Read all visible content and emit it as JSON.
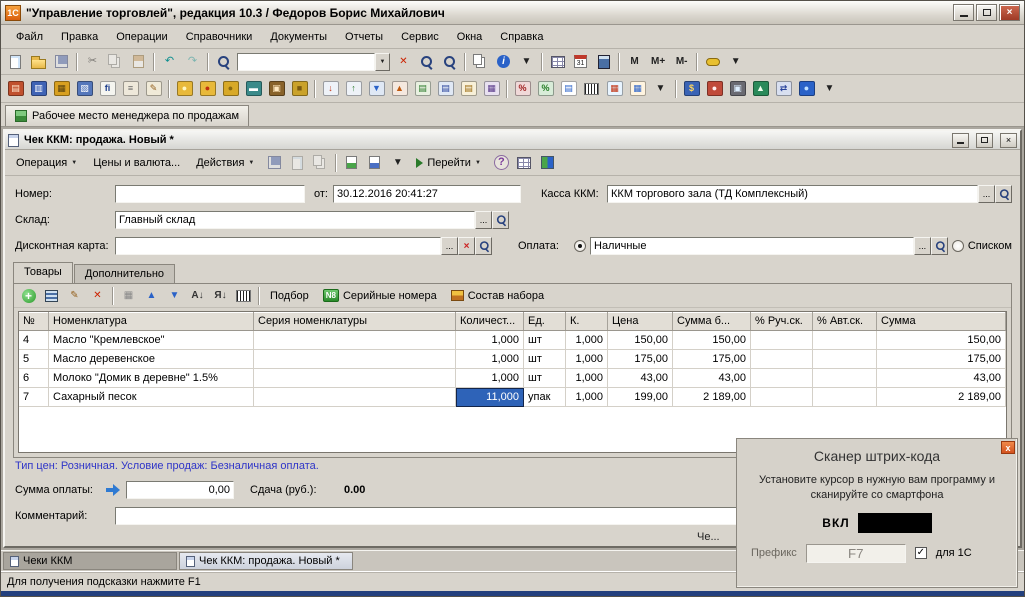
{
  "colors": {
    "selection_blue": "#2e63b8",
    "info_text_blue": "#2f35c8",
    "logo_orange": "#d95f0e",
    "bottom_strip_navy": "#23407e"
  },
  "ui": {
    "ellipsis": "...",
    "dropdown": "▼",
    "clear": "×"
  },
  "window": {
    "title": "\"Управление торговлей\", редакция 10.3 / Федоров Борис Михайлович"
  },
  "menu": {
    "items": [
      {
        "id": "file",
        "label": "Файл"
      },
      {
        "id": "edit",
        "label": "Правка"
      },
      {
        "id": "operations",
        "label": "Операции"
      },
      {
        "id": "catalogs",
        "label": "Справочники"
      },
      {
        "id": "documents",
        "label": "Документы"
      },
      {
        "id": "reports",
        "label": "Отчеты"
      },
      {
        "id": "service",
        "label": "Сервис"
      },
      {
        "id": "windows",
        "label": "Окна"
      },
      {
        "id": "help",
        "label": "Справка"
      }
    ]
  },
  "toolbar1": {
    "items": [
      {
        "n": "new-document",
        "s": "page"
      },
      {
        "n": "open-file",
        "s": "folder"
      },
      {
        "n": "save",
        "s": "floppy",
        "dim": true
      },
      {
        "t": "sep"
      },
      {
        "n": "cut",
        "g": "✂",
        "dim": true
      },
      {
        "n": "copy",
        "s": "copy",
        "dim": true
      },
      {
        "n": "paste",
        "s": "paste",
        "dim": true
      },
      {
        "t": "sep"
      },
      {
        "n": "undo",
        "g": "↶",
        "fg": "#0e8f8f"
      },
      {
        "n": "redo",
        "g": "↷",
        "fg": "#0e8f8f",
        "dim": true
      },
      {
        "t": "sep"
      },
      {
        "n": "find",
        "s": "mag"
      },
      {
        "t": "combo",
        "n": "quick-search",
        "v": ""
      },
      {
        "n": "clear-find",
        "t": "txt",
        "g": "✕",
        "fg": "#cc2200"
      },
      {
        "n": "find-next",
        "s": "mag"
      },
      {
        "n": "find-previous",
        "s": "mag"
      },
      {
        "t": "sep"
      },
      {
        "n": "copy-to-clipboard",
        "s": "copy"
      },
      {
        "n": "clipboard-info",
        "s": "info",
        "g": "i"
      },
      {
        "n": "info-dropdown",
        "t": "txt",
        "g": "▼",
        "fg": "#222"
      },
      {
        "t": "sep"
      },
      {
        "n": "show-table",
        "s": "grid"
      },
      {
        "n": "calendar",
        "s": "cal",
        "g": "31"
      },
      {
        "n": "calculator",
        "s": "calc"
      },
      {
        "t": "sep"
      },
      {
        "n": "memory-store",
        "t": "txt",
        "g": "M"
      },
      {
        "n": "memory-plus",
        "t": "txt",
        "g": "M+"
      },
      {
        "n": "memory-minus",
        "t": "txt",
        "g": "M-"
      },
      {
        "t": "sep"
      },
      {
        "n": "temporary-lock",
        "s": "key"
      },
      {
        "n": "toolbar-options",
        "t": "txt",
        "g": "▼",
        "fg": "#222"
      }
    ]
  },
  "toolbar2": {
    "items": [
      {
        "n": "receipt-printer",
        "s": "block",
        "bg": "#c0502e",
        "g": "▤",
        "fg": "#ffe8d0"
      },
      {
        "n": "documents-journal",
        "s": "block",
        "bg": "#3f63b5",
        "g": "▥",
        "fg": "#ffffff"
      },
      {
        "n": "report-builder",
        "s": "block",
        "bg": "#d8a020",
        "g": "▦",
        "fg": "#5a4410"
      },
      {
        "n": "print-document",
        "s": "block",
        "bg": "#5577bb",
        "g": "▧",
        "fg": "#ffffff"
      },
      {
        "n": "fiscal-ledger",
        "s": "block",
        "bg": "#f5f5f0",
        "g": "fi",
        "fg": "#1a3c8c"
      },
      {
        "n": "notepad",
        "s": "block",
        "bg": "#eee8da",
        "g": "≡",
        "fg": "#666666"
      },
      {
        "n": "edit-settings",
        "s": "block",
        "bg": "#f0ead8",
        "g": "✎",
        "fg": "#95611e"
      },
      {
        "t": "sep"
      },
      {
        "n": "cash-in",
        "s": "block",
        "bg": "#e8b93a",
        "g": "●",
        "fg": "#fff6c0"
      },
      {
        "n": "cash-out",
        "s": "block",
        "bg": "#e8b93a",
        "g": "●",
        "fg": "#c03010"
      },
      {
        "n": "coins",
        "s": "block",
        "bg": "#d8a928",
        "g": "●",
        "fg": "#8a6a10"
      },
      {
        "n": "payment-card",
        "s": "block",
        "bg": "#3a8a8a",
        "g": "▬",
        "fg": "#ffffff"
      },
      {
        "n": "cash-register",
        "s": "block",
        "bg": "#88622a",
        "g": "▣",
        "fg": "#ffe8c0"
      },
      {
        "n": "money-box",
        "s": "block",
        "bg": "#caa22a",
        "g": "■",
        "fg": "#7a5a10"
      },
      {
        "t": "sep"
      },
      {
        "n": "incoming-invoice",
        "s": "block",
        "bg": "#eef2f8",
        "g": "↓",
        "fg": "#c03010"
      },
      {
        "n": "outgoing-invoice",
        "s": "block",
        "bg": "#eef2f8",
        "g": "↑",
        "fg": "#2a7a2a"
      },
      {
        "n": "goods-receipt",
        "s": "block",
        "bg": "#dfe8f5",
        "g": "▼",
        "fg": "#2a62c8"
      },
      {
        "n": "goods-return",
        "s": "block",
        "bg": "#f5e8df",
        "g": "▲",
        "fg": "#c05a10"
      },
      {
        "n": "sales-invoice",
        "s": "block",
        "bg": "#e8f0e0",
        "g": "▤",
        "fg": "#2a7a2a"
      },
      {
        "n": "purchase-order",
        "s": "block",
        "bg": "#e0e8f5",
        "g": "▤",
        "fg": "#28429a"
      },
      {
        "n": "customer-order",
        "s": "block",
        "bg": "#f8f0d8",
        "g": "▤",
        "fg": "#9a6a10"
      },
      {
        "n": "inventory-check",
        "s": "block",
        "bg": "#e8e0f0",
        "g": "▦",
        "fg": "#5a3a8a"
      },
      {
        "t": "sep"
      },
      {
        "n": "repricing",
        "s": "block",
        "bg": "#f0d8d8",
        "g": "%",
        "fg": "#a02020"
      },
      {
        "n": "discount-cards",
        "s": "block",
        "bg": "#d8ecd8",
        "g": "%",
        "fg": "#207a20"
      },
      {
        "n": "price-list",
        "s": "block",
        "bg": "#ffffff",
        "g": "▤",
        "fg": "#2a62c8"
      },
      {
        "n": "barcode",
        "s": "barcode"
      },
      {
        "n": "sales-report",
        "s": "block",
        "bg": "#e8f4ff",
        "g": "▦",
        "fg": "#c03010"
      },
      {
        "n": "stock-report",
        "s": "block",
        "bg": "#fff4e0",
        "g": "▦",
        "fg": "#2a62c8"
      },
      {
        "n": "more-commands-dropdown",
        "t": "txt",
        "g": "▼",
        "fg": "#222"
      },
      {
        "t": "sep"
      },
      {
        "n": "exchange-rates",
        "s": "block",
        "bg": "#3a63b5",
        "g": "$",
        "fg": "#ffd760"
      },
      {
        "n": "crm-contacts",
        "s": "block",
        "bg": "#c04a3a",
        "g": "●",
        "fg": "#ffeeee"
      },
      {
        "n": "retail-equipment",
        "s": "block",
        "bg": "#6a6a72",
        "g": "▣",
        "fg": "#ddeeff"
      },
      {
        "n": "scales-device",
        "s": "block",
        "bg": "#2a8a5a",
        "g": "▲",
        "fg": "#eeffee"
      },
      {
        "n": "data-exchange",
        "s": "block",
        "bg": "#d8dff0",
        "g": "⇄",
        "fg": "#28429a"
      },
      {
        "n": "internet-support",
        "s": "block",
        "bg": "#2a62c8",
        "g": "●",
        "fg": "#bfe0ff"
      },
      {
        "n": "equipment-options-dropdown",
        "t": "txt",
        "g": "▼",
        "fg": "#222"
      }
    ]
  },
  "workspace_tab": {
    "label": "Рабочее место менеджера по продажам"
  },
  "document": {
    "title": "Чек ККМ: продажа. Новый *",
    "toolbar": {
      "operation_label": "Операция",
      "prices_label": "Цены и валюта...",
      "actions_label": "Действия",
      "goto_label": "Перейти",
      "icons1": [
        {
          "n": "save-document",
          "s": "floppy",
          "dim": true
        },
        {
          "n": "preview-document",
          "s": "page",
          "dim": true
        },
        {
          "n": "copy-document",
          "s": "copy",
          "dim": true
        },
        {
          "t": "sep"
        },
        {
          "n": "post-document",
          "s": "doc-green"
        },
        {
          "n": "print-check",
          "s": "doc-blue"
        },
        {
          "n": "doc-more-dropdown",
          "t": "txt",
          "g": "▼",
          "fg": "#222"
        }
      ],
      "icons2": [
        {
          "n": "document-list-view",
          "s": "grid"
        },
        {
          "n": "document-structure",
          "s": "struct"
        }
      ]
    },
    "fields": {
      "number_label": "Номер:",
      "number_value": "",
      "date_label": "от:",
      "date_value": "30.12.2016 20:41:27",
      "kkm_label": "Касса ККМ:",
      "kkm_value": "ККМ торгового зала (ТД Комплексный)",
      "warehouse_label": "Склад:",
      "warehouse_value": "Главный склад",
      "discount_label": "Дисконтная карта:",
      "discount_value": "",
      "payment_label": "Оплата:",
      "payment_value": "Наличные",
      "payment_alt_label": "Списком"
    },
    "tabs": [
      {
        "id": "goods",
        "label": "Товары",
        "active": true
      },
      {
        "id": "extra",
        "label": "Дополнительно",
        "active": false
      }
    ],
    "table_toolbar": {
      "icons": [
        {
          "n": "add-row",
          "s": "plus",
          "g": "+"
        },
        {
          "n": "add-copy-row",
          "s": "rows"
        },
        {
          "n": "edit-row",
          "t": "txt",
          "g": "✎",
          "fg": "#95611e"
        },
        {
          "n": "delete-row",
          "t": "txt",
          "g": "✕",
          "fg": "#cc2200"
        },
        {
          "t": "sep"
        },
        {
          "n": "finish-editing",
          "t": "txt",
          "g": "▦",
          "fg": "#888888"
        },
        {
          "n": "move-row-up",
          "t": "txt",
          "g": "▲",
          "fg": "#2a62c8"
        },
        {
          "n": "move-row-down",
          "t": "txt",
          "g": "▼",
          "fg": "#2a62c8"
        },
        {
          "n": "sort-ascending",
          "t": "txt",
          "g": "А↓",
          "fg": "#333333"
        },
        {
          "n": "sort-descending",
          "t": "txt",
          "g": "Я↓",
          "fg": "#333333"
        },
        {
          "n": "show-barcode",
          "s": "barcode"
        },
        {
          "t": "sep"
        }
      ],
      "podbor_label": "Подбор",
      "serial_badge": "N8",
      "serial_label": "Серийные номера",
      "set_label": "Состав набора"
    },
    "table": {
      "columns": [
        "№",
        "Номенклатура",
        "Серия номенклатуры",
        "Количест...",
        "Ед.",
        "К.",
        "Цена",
        "Сумма б...",
        "% Руч.ск.",
        "% Авт.ск.",
        "Сумма"
      ],
      "rows": [
        {
          "num": "4",
          "name": "Масло \"Кремлевское\"",
          "series": "",
          "qty": "1,000",
          "unit": "шт",
          "k": "1,000",
          "price": "150,00",
          "sum_no_disc": "150,00",
          "manual_disc": "",
          "auto_disc": "",
          "sum": "150,00",
          "selected": false
        },
        {
          "num": "5",
          "name": "Масло деревенское",
          "series": "",
          "qty": "1,000",
          "unit": "шт",
          "k": "1,000",
          "price": "175,00",
          "sum_no_disc": "175,00",
          "manual_disc": "",
          "auto_disc": "",
          "sum": "175,00",
          "selected": false
        },
        {
          "num": "6",
          "name": "Молоко \"Домик в деревне\" 1.5%",
          "series": "",
          "qty": "1,000",
          "unit": "шт",
          "k": "1,000",
          "price": "43,00",
          "sum_no_disc": "43,00",
          "manual_disc": "",
          "auto_disc": "",
          "sum": "43,00",
          "selected": false
        },
        {
          "num": "7",
          "name": "Сахарный песок",
          "series": "",
          "qty": "11,000",
          "unit": "упак",
          "k": "1,000",
          "price": "199,00",
          "sum_no_disc": "2 189,00",
          "manual_disc": "",
          "auto_disc": "",
          "sum": "2 189,00",
          "selected": true
        }
      ]
    },
    "info_line": "Тип цен: Розничная. Условие продаж: Безналичная оплата.",
    "payment": {
      "label": "Сумма оплаты:",
      "value": "0,00",
      "change_label": "Сдача (руб.):",
      "change_value": "0.00"
    },
    "comment": {
      "label": "Комментарий:",
      "value": ""
    },
    "clipped_text": "Че..."
  },
  "bottom_tabs": [
    {
      "id": "checks-journal",
      "label": "Чеки ККМ",
      "active": false
    },
    {
      "id": "check-sale-new",
      "label": "Чек ККМ: продажа. Новый *",
      "active": true
    }
  ],
  "status_bar": {
    "text": "Для получения подсказки нажмите F1"
  },
  "scanner": {
    "title": "Сканер штрих-кода",
    "instruction": "Установите курсор в нужную вам программу и сканируйте со смартфона",
    "on_label": "ВКЛ",
    "prefix_label": "Префикс",
    "prefix_value": "F7",
    "for_1c_label": "для 1С",
    "for_1c_checked": true
  }
}
